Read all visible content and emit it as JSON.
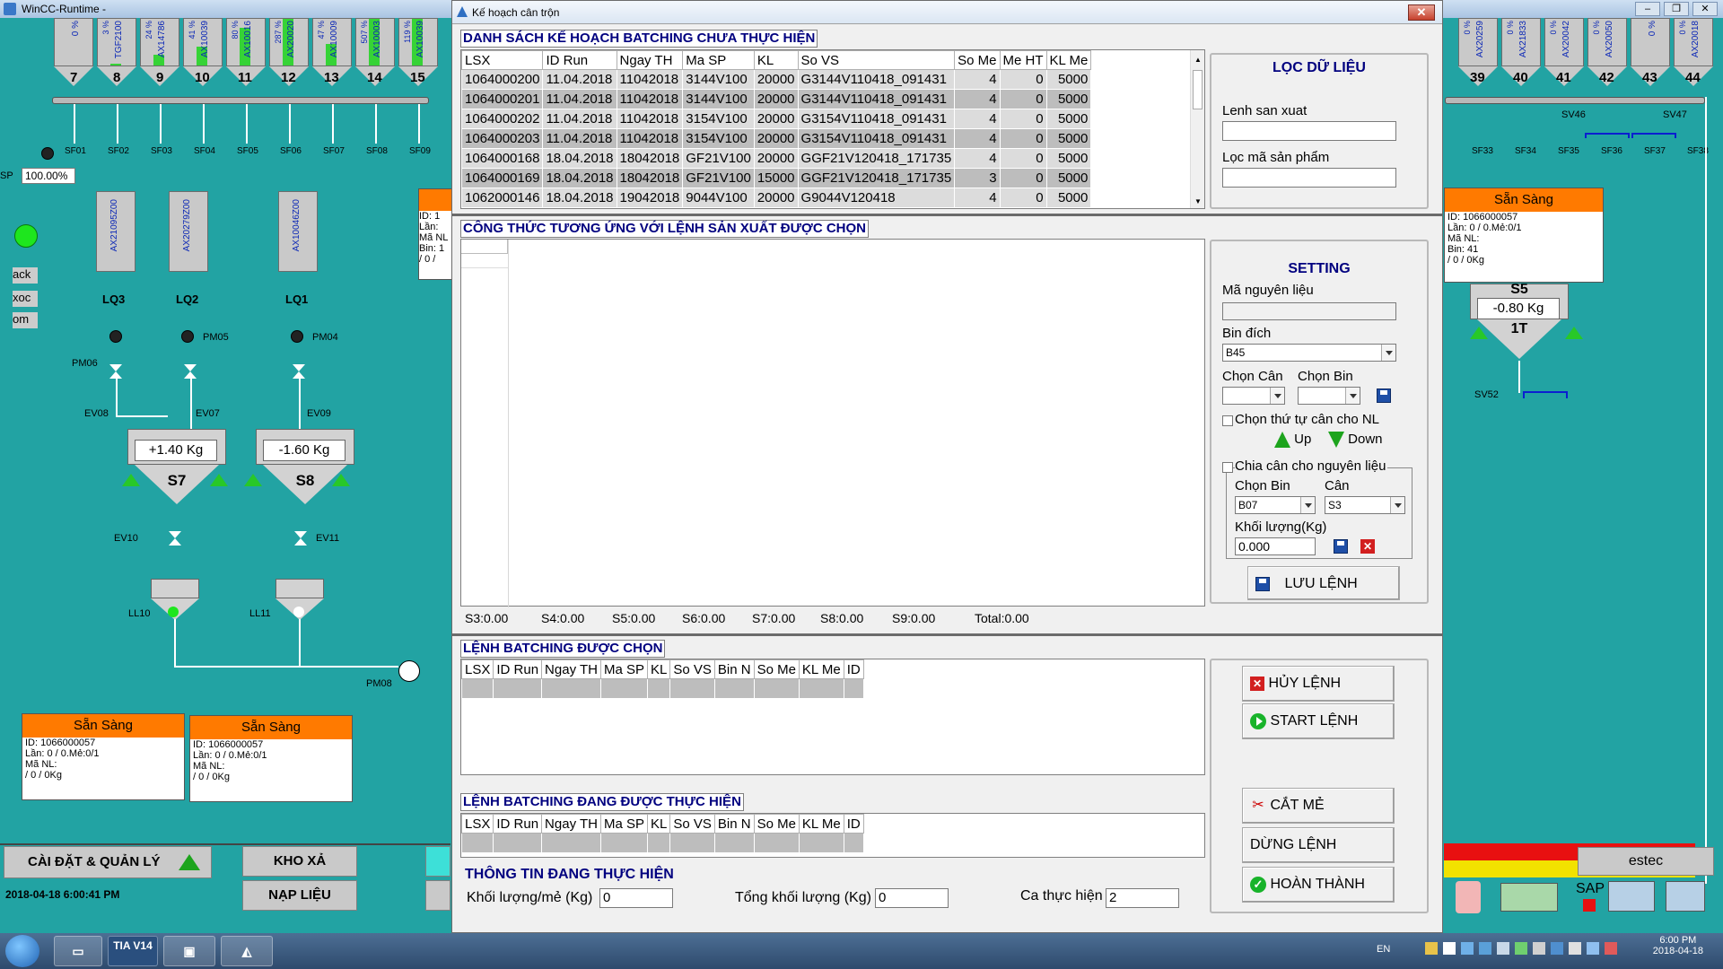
{
  "bg": {
    "window_title": "WinCC-Runtime -",
    "silos_left": [
      {
        "num": "7",
        "label": "0 %",
        "fill": 0
      },
      {
        "num": "8",
        "label": "TGF2100",
        "pct": "3 %",
        "fill": 0.03
      },
      {
        "num": "9",
        "label": "AX14786",
        "pct": "24 %",
        "fill": 0.24
      },
      {
        "num": "10",
        "label": "AX10039",
        "pct": "41 %",
        "fill": 0.41
      },
      {
        "num": "11",
        "label": "AX10016",
        "pct": "80 %",
        "fill": 0.8
      },
      {
        "num": "12",
        "label": "AX20020",
        "pct": "287 %",
        "fill": 1
      },
      {
        "num": "13",
        "label": "AX10009",
        "pct": "47 %",
        "fill": 0.47
      },
      {
        "num": "14",
        "label": "AX10003",
        "pct": "507 %",
        "fill": 1
      },
      {
        "num": "15",
        "label": "AX10039",
        "pct": "119 %",
        "fill": 1
      }
    ],
    "sf_left": [
      "SF01",
      "SF02",
      "SF03",
      "SF04",
      "SF05",
      "SF06",
      "SF07",
      "SF08",
      "SF09"
    ],
    "sp_label": "SP",
    "sp_value": "100.00%",
    "side_buttons": [
      "ack",
      "xoc",
      "om"
    ],
    "hoppers": [
      {
        "name": "LQ3",
        "label": "AX21095Z00",
        "pct": "0 %"
      },
      {
        "name": "LQ2",
        "label": "AX20279Z00",
        "pct": "0 %"
      },
      {
        "name": "LQ1",
        "label": "AX10046Z00",
        "pct": "0 %"
      }
    ],
    "pumps": [
      "PM05",
      "PM04",
      "PM06",
      "PM08"
    ],
    "valves": [
      "EV08",
      "EV07",
      "EV09",
      "EV10",
      "EV11",
      "LL10",
      "LL11"
    ],
    "scale_s7": {
      "name": "S7",
      "value": "+1.40  Kg"
    },
    "scale_s8": {
      "name": "S8",
      "value": "-1.60  Kg"
    },
    "ready_cards": [
      {
        "title": "Sẵn Sàng",
        "l1": "ID: 1066000057",
        "l2": "Lần: 0 / 0.Mẻ:0/1",
        "l3": "Mã NL:",
        "l4": " / 0 / 0Kg"
      },
      {
        "title": "Sẵn Sàng",
        "l1": "ID: 1066000057",
        "l2": "Lần: 0 / 0.Mẻ:0/1",
        "l3": "Mã NL:",
        "l4": " / 0 / 0Kg"
      }
    ],
    "right_card": {
      "title": "Sẵn Sàng",
      "l1": "ID: 1066000057",
      "l2": "Lần: 0 / 0.Mẻ:0/1",
      "l3": "Mã NL:",
      "l4": "Bin: 41",
      "l5": " / 0 / 0Kg"
    },
    "left_card_partial": {
      "l1": "ID: 1",
      "l2": "Lần:",
      "l3": "Mã NL",
      "l4": "Bin: 1",
      "l5": " / 0 /"
    },
    "silos_right": [
      {
        "num": "39",
        "label": "AX20259",
        "pct": "0 %"
      },
      {
        "num": "40",
        "label": "AX21833",
        "pct": "0 %"
      },
      {
        "num": "41",
        "label": "AX20042",
        "pct": "0 %"
      },
      {
        "num": "42",
        "label": "AX20050",
        "pct": "0 %"
      },
      {
        "num": "43",
        "label": "0 %",
        "pct": ""
      },
      {
        "num": "44",
        "label": "AX20018",
        "pct": "0 %"
      }
    ],
    "sf_right": [
      "SF33",
      "SF34",
      "SF35",
      "SF36",
      "SF37",
      "SF38"
    ],
    "sv_right": [
      "SV46",
      "SV47",
      "SV52"
    ],
    "scale_s5": {
      "name": "S5",
      "value": "-0.80  Kg",
      "sub": "1T"
    },
    "btn_setup": "CÀI ĐẶT & QUẢN LÝ",
    "btn_kho_xa": "KHO XẢ",
    "btn_nap_lieu": "NẠP LIỆU",
    "datetime": "2018-04-18 6:00:41 PM",
    "estec": "estec",
    "sap": "SAP"
  },
  "dialog": {
    "title": "Kế hoạch cân trộn",
    "close": "✕",
    "plan_head": "DANH SÁCH KẾ HOẠCH BATCHING CHƯA THỰC HIỆN",
    "plan_cols": [
      "LSX",
      "ID Run",
      "Ngay TH",
      "Ma SP",
      "KL",
      "So VS",
      "So Me",
      "Me HT",
      "KL Me"
    ],
    "plan_rows": [
      [
        "1064000200",
        "11.04.2018",
        "11042018",
        "3144V100",
        "20000",
        "G3144V110418_091431",
        "4",
        "0",
        "5000"
      ],
      [
        "1064000201",
        "11.04.2018",
        "11042018",
        "3144V100",
        "20000",
        "G3144V110418_091431",
        "4",
        "0",
        "5000"
      ],
      [
        "1064000202",
        "11.04.2018",
        "11042018",
        "3154V100",
        "20000",
        "G3154V110418_091431",
        "4",
        "0",
        "5000"
      ],
      [
        "1064000203",
        "11.04.2018",
        "11042018",
        "3154V100",
        "20000",
        "G3154V110418_091431",
        "4",
        "0",
        "5000"
      ],
      [
        "1064000168",
        "18.04.2018",
        "18042018",
        "GF21V100",
        "20000",
        "GGF21V120418_171735",
        "4",
        "0",
        "5000"
      ],
      [
        "1064000169",
        "18.04.2018",
        "18042018",
        "GF21V100",
        "15000",
        "GGF21V120418_171735",
        "3",
        "0",
        "5000"
      ],
      [
        "1062000146",
        "18.04.2018",
        "19042018",
        "9044V100",
        "20000",
        "G9044V120418",
        "4",
        "0",
        "5000"
      ]
    ],
    "filter": {
      "title": "LỌC DỮ LIỆU",
      "lenh_label": "Lenh san xuat",
      "lenh_value": "",
      "ma_sp_label": "Lọc mã sản phẩm",
      "ma_sp_value": ""
    },
    "recipe_head": "CÔNG THỨC TƯƠNG ỨNG VỚI LỆNH SẢN XUẤT ĐƯỢC CHỌN",
    "totals": [
      "S3:0.00",
      "S4:0.00",
      "S5:0.00",
      "S6:0.00",
      "S7:0.00",
      "S8:0.00",
      "S9:0.00",
      "Total:0.00"
    ],
    "setting": {
      "title": "SETTING",
      "ma_nl_label": "Mã nguyên liệu",
      "ma_nl_value": "",
      "bin_dich_label": "Bin đích",
      "bin_dich_value": "B45",
      "chon_can_label": "Chọn Cân",
      "chon_bin_label": "Chọn Bin",
      "order_label": "Chọn thứ tự cân cho NL",
      "up_label": "Up",
      "down_label": "Down",
      "split_label": "Chia cân cho nguyên liệu",
      "split_bin_label": "Chọn Bin",
      "split_can_label": "Cân",
      "split_bin_value": "B07",
      "split_can_value": "S3",
      "kl_label": "Khối lượng(Kg)",
      "kl_value": "0.000",
      "save_btn": "LƯU LỆNH"
    },
    "chosen_head": "LỆNH BATCHING ĐƯỢC CHỌN",
    "chosen_cols": [
      "LSX",
      "ID Run",
      "Ngay TH",
      "Ma SP",
      "KL",
      "So VS",
      "Bin N",
      "So Me",
      "KL Me",
      "ID"
    ],
    "running_head": "LỆNH BATCHING ĐANG ĐƯỢC THỰC HIỆN",
    "running_cols": [
      "LSX",
      "ID Run",
      "Ngay TH",
      "Ma SP",
      "KL",
      "So VS",
      "Bin N",
      "So Me",
      "KL Me",
      "ID"
    ],
    "info_head": "THÔNG TIN ĐANG THỰC HIỆN",
    "kl_me_label": "Khối lượng/mẻ (Kg)",
    "kl_me_value": "0",
    "tong_kl_label": "Tổng khối lượng (Kg)",
    "tong_kl_value": "0",
    "ca_label": "Ca thực hiện",
    "ca_value": "2",
    "btn_huy": "HỦY LỆNH",
    "btn_start": "START LỆNH",
    "btn_cat": "CẮT MẺ",
    "btn_dung": "DỪNG LỆNH",
    "btn_hoan": "HOÀN THÀNH"
  },
  "taskbar": {
    "tia": "TIA V14",
    "lang": "EN",
    "time": "6:00 PM",
    "date": "2018-04-18"
  }
}
